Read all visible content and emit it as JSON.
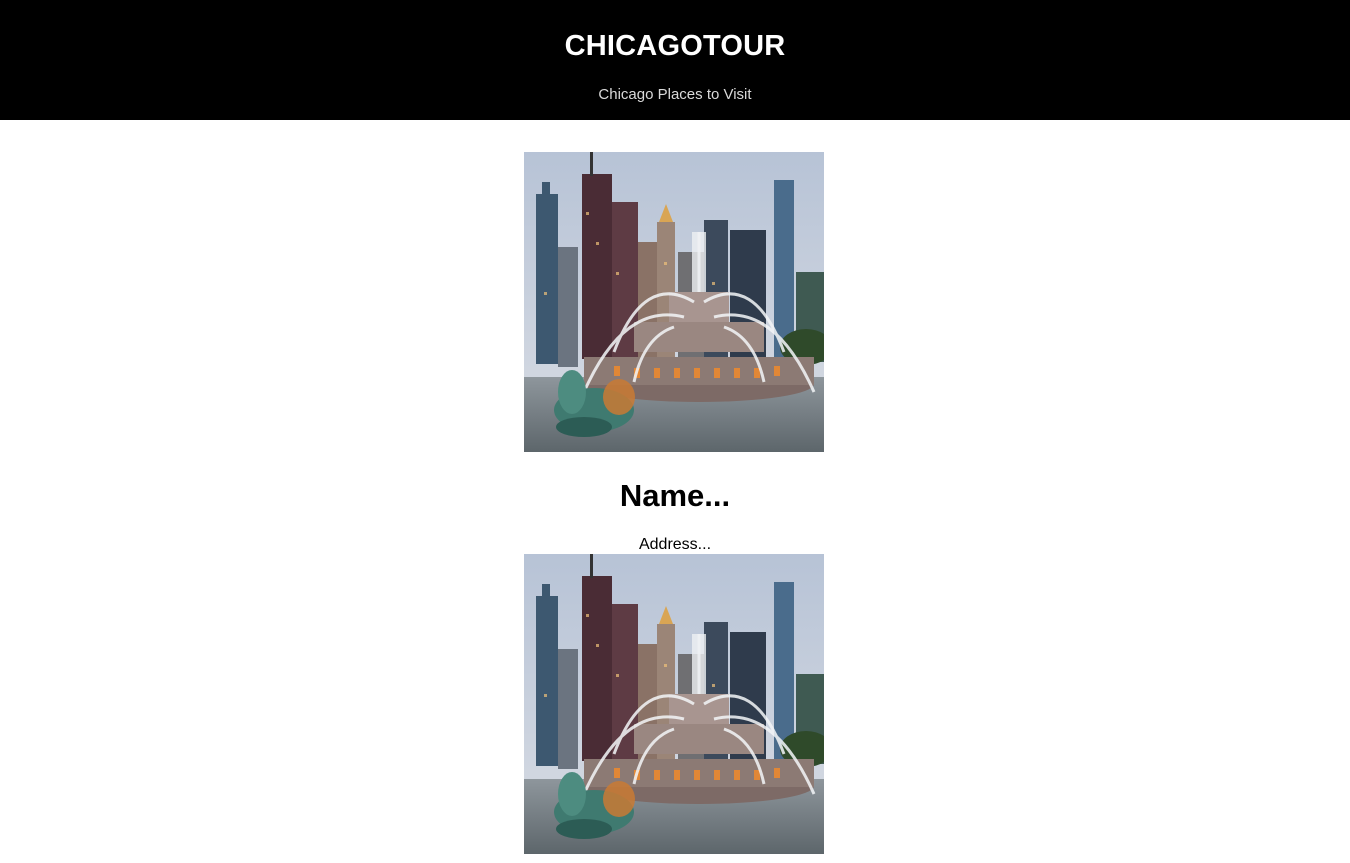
{
  "header": {
    "title": "CHICAGOTOUR",
    "subtitle": "Chicago Places to Visit"
  },
  "places": [
    {
      "photo_subject": "buckingham-fountain-skyline",
      "name": "Name...",
      "address": "Address..."
    },
    {
      "photo_subject": "buckingham-fountain-skyline"
    }
  ],
  "colors": {
    "header_bg": "#000000",
    "header_title": "#ffffff",
    "header_subtitle": "#d9d9d9",
    "page_bg": "#ffffff"
  }
}
